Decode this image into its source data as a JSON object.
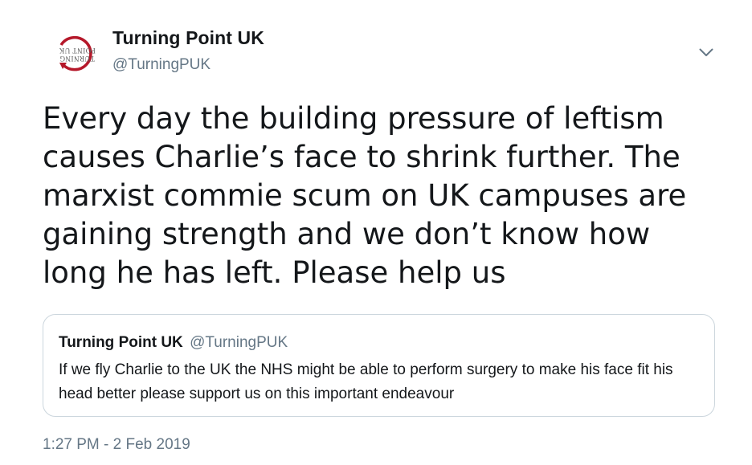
{
  "tweet": {
    "author": {
      "name": "Turning Point UK",
      "handle": "@TurningPUK",
      "avatar_logo_text": "TURNING POINT UK",
      "avatar_icon": "turning-point-uk-logo"
    },
    "text": "Every day the building pressure of leftism causes Charlie’s face to shrink further. The marxist commie scum on UK campuses are gaining strength and we don’t know how long he has left. Please help us",
    "menu_icon": "chevron-down-icon",
    "quoted_tweet": {
      "author_name": "Turning Point UK",
      "author_handle": "@TurningPUK",
      "text": "If we fly Charlie to the UK the NHS might be able to perform surgery to make his face fit his head better please support us on this important endeavour"
    },
    "timestamp": "1:27 PM - 2 Feb 2019"
  },
  "colors": {
    "text_primary": "#14171a",
    "text_secondary": "#657786",
    "card_border": "#ccd6dd",
    "logo_red": "#b5182a",
    "logo_grey": "#5a5a5a"
  }
}
